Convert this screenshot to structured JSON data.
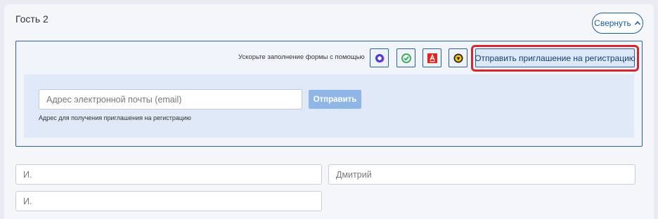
{
  "guest": {
    "title": "Гость 2",
    "collapse_label": "Свернуть"
  },
  "invite": {
    "speedup_label": "Ускорьте заполнение формы с помощью",
    "services": [
      {
        "icon": "blue-ring-logo-icon",
        "color": "#4a3dd6"
      },
      {
        "icon": "green-check-logo-icon",
        "color": "#2fa84f"
      },
      {
        "icon": "alfa-bank-logo-icon",
        "color": "#e0271f"
      },
      {
        "icon": "yellow-badge-logo-icon",
        "color": "#f0c419"
      }
    ],
    "button_label": "Отправить приглашение на регистрацию",
    "highlight_color": "#d7262e"
  },
  "email": {
    "placeholder": "Адрес электронной почты (email)",
    "value": "",
    "send_label": "Отправить",
    "hint": "Адрес для получения приглашения на регистрацию"
  },
  "fields": [
    {
      "placeholder": "И.",
      "value": ""
    },
    {
      "placeholder": "Дмитрий",
      "value": ""
    },
    {
      "placeholder": "И.",
      "value": ""
    }
  ]
}
